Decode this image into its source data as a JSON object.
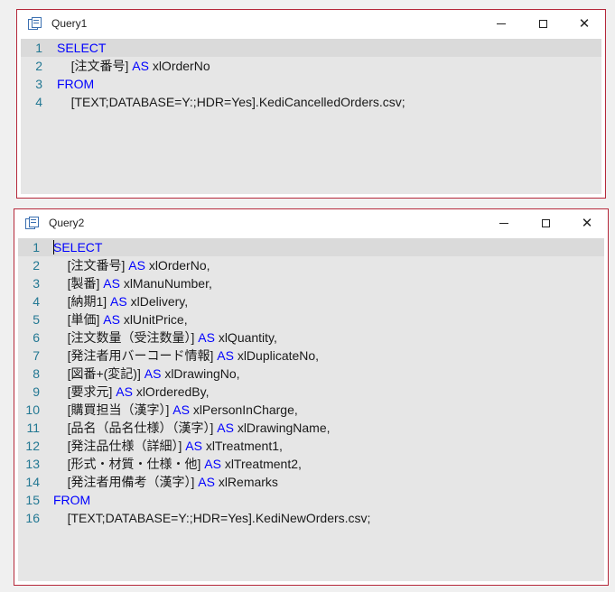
{
  "windows": [
    {
      "title": "Query1",
      "lines": [
        {
          "num": "1",
          "indent": "",
          "parts": [
            {
              "kw": true,
              "text": "SELECT"
            }
          ]
        },
        {
          "num": "2",
          "indent": "    ",
          "parts": [
            {
              "kw": false,
              "text": "[注文番号]"
            },
            {
              "kw": true,
              "text": " AS "
            },
            {
              "kw": false,
              "text": "xlOrderNo"
            }
          ]
        },
        {
          "num": "3",
          "indent": "",
          "parts": [
            {
              "kw": true,
              "text": "FROM"
            }
          ]
        },
        {
          "num": "4",
          "indent": "    ",
          "parts": [
            {
              "kw": false,
              "text": "[TEXT;DATABASE=Y:;HDR=Yes].KediCancelledOrders.csv;"
            }
          ]
        }
      ]
    },
    {
      "title": "Query2",
      "lines": [
        {
          "num": "1",
          "indent": "",
          "parts": [
            {
              "kw": true,
              "text": "SELECT"
            }
          ]
        },
        {
          "num": "2",
          "indent": "    ",
          "parts": [
            {
              "kw": false,
              "text": "[注文番号]"
            },
            {
              "kw": true,
              "text": " AS "
            },
            {
              "kw": false,
              "text": "xlOrderNo,"
            }
          ]
        },
        {
          "num": "3",
          "indent": "    ",
          "parts": [
            {
              "kw": false,
              "text": "[製番]"
            },
            {
              "kw": true,
              "text": " AS "
            },
            {
              "kw": false,
              "text": "xlManuNumber,"
            }
          ]
        },
        {
          "num": "4",
          "indent": "    ",
          "parts": [
            {
              "kw": false,
              "text": "[納期1]"
            },
            {
              "kw": true,
              "text": " AS "
            },
            {
              "kw": false,
              "text": "xlDelivery,"
            }
          ]
        },
        {
          "num": "5",
          "indent": "    ",
          "parts": [
            {
              "kw": false,
              "text": "[単価]"
            },
            {
              "kw": true,
              "text": " AS "
            },
            {
              "kw": false,
              "text": "xlUnitPrice,"
            }
          ]
        },
        {
          "num": "6",
          "indent": "    ",
          "parts": [
            {
              "kw": false,
              "text": "[注文数量（受注数量）]"
            },
            {
              "kw": true,
              "text": " AS "
            },
            {
              "kw": false,
              "text": "xlQuantity,"
            }
          ]
        },
        {
          "num": "7",
          "indent": "    ",
          "parts": [
            {
              "kw": false,
              "text": "[発注者用バーコード情報]"
            },
            {
              "kw": true,
              "text": " AS "
            },
            {
              "kw": false,
              "text": "xlDuplicateNo,"
            }
          ]
        },
        {
          "num": "8",
          "indent": "    ",
          "parts": [
            {
              "kw": false,
              "text": "[図番+(変記)]"
            },
            {
              "kw": true,
              "text": " AS "
            },
            {
              "kw": false,
              "text": "xlDrawingNo,"
            }
          ]
        },
        {
          "num": "9",
          "indent": "    ",
          "parts": [
            {
              "kw": false,
              "text": "[要求元]"
            },
            {
              "kw": true,
              "text": " AS "
            },
            {
              "kw": false,
              "text": "xlOrderedBy,"
            }
          ]
        },
        {
          "num": "10",
          "indent": "    ",
          "parts": [
            {
              "kw": false,
              "text": "[購買担当（漢字）]"
            },
            {
              "kw": true,
              "text": " AS "
            },
            {
              "kw": false,
              "text": "xlPersonInCharge,"
            }
          ]
        },
        {
          "num": "11",
          "indent": "    ",
          "parts": [
            {
              "kw": false,
              "text": "[品名（品名仕様）（漢字）]"
            },
            {
              "kw": true,
              "text": " AS "
            },
            {
              "kw": false,
              "text": "xlDrawingName,"
            }
          ]
        },
        {
          "num": "12",
          "indent": "    ",
          "parts": [
            {
              "kw": false,
              "text": "[発注品仕様（詳細）]"
            },
            {
              "kw": true,
              "text": " AS "
            },
            {
              "kw": false,
              "text": "xlTreatment1,"
            }
          ]
        },
        {
          "num": "13",
          "indent": "    ",
          "parts": [
            {
              "kw": false,
              "text": "[形式・材質・仕様・他]"
            },
            {
              "kw": true,
              "text": " AS "
            },
            {
              "kw": false,
              "text": "xlTreatment2,"
            }
          ]
        },
        {
          "num": "14",
          "indent": "    ",
          "parts": [
            {
              "kw": false,
              "text": "[発注者用備考（漢字）]"
            },
            {
              "kw": true,
              "text": " AS "
            },
            {
              "kw": false,
              "text": "xlRemarks"
            }
          ]
        },
        {
          "num": "15",
          "indent": "",
          "parts": [
            {
              "kw": true,
              "text": "FROM"
            }
          ]
        },
        {
          "num": "16",
          "indent": "    ",
          "parts": [
            {
              "kw": false,
              "text": "[TEXT;DATABASE=Y:;HDR=Yes].KediNewOrders.csv;"
            }
          ]
        }
      ]
    }
  ],
  "controls": {
    "minimize_icon": "minimize-icon",
    "maximize_icon": "maximize-icon",
    "close_glyph": "✕"
  },
  "colors": {
    "keyword": "#0000ff",
    "line_number": "#237893",
    "window_border": "#b5283a",
    "editor_bg": "#e6e6e6"
  }
}
